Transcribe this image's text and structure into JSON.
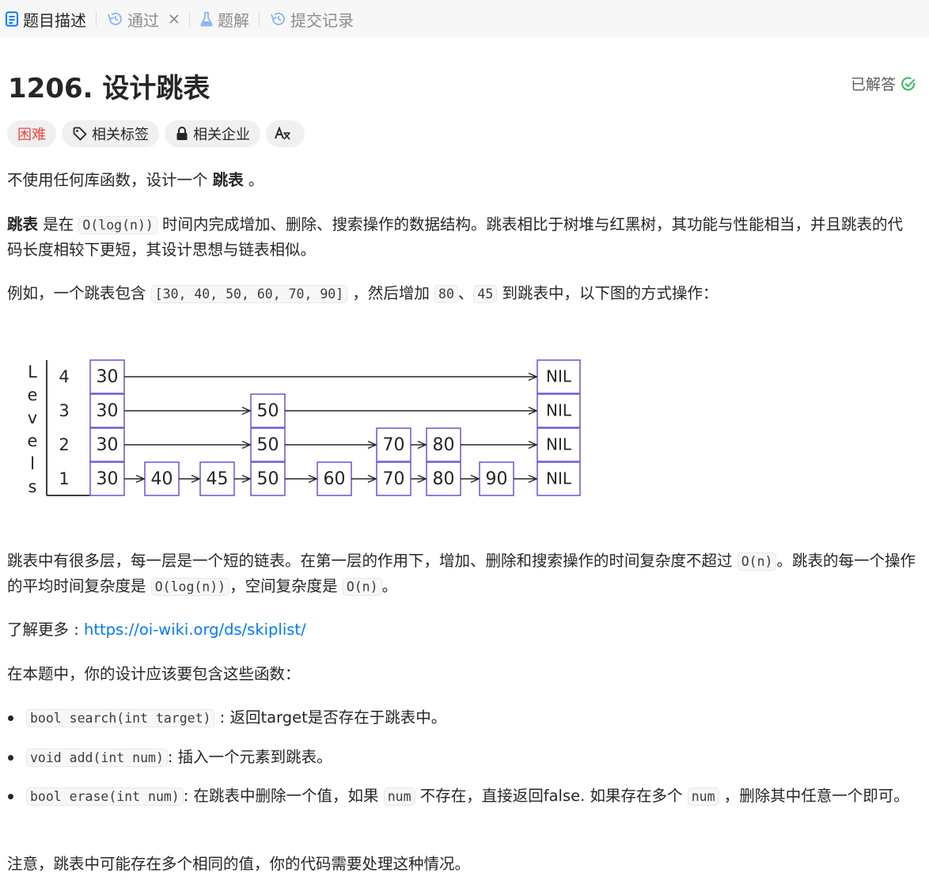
{
  "tabs": [
    {
      "label": "题目描述"
    },
    {
      "label": "通过"
    },
    {
      "label": "题解"
    },
    {
      "label": "提交记录"
    }
  ],
  "problem": {
    "title": "1206. 设计跳表",
    "status": "已解答"
  },
  "tags": {
    "difficulty": "困难",
    "related_tags": "相关标签",
    "related_companies": "相关企业"
  },
  "content": {
    "p1": {
      "a": "不使用任何库函数，设计一个 ",
      "b": "跳表",
      "c": " 。"
    },
    "p2": {
      "b": "跳表",
      "a": " 是在 ",
      "code": "O(log(n))",
      "c": " 时间内完成增加、删除、搜索操作的数据结构。跳表相比于树堆与红黑树，其功能与性能相当，并且跳表的代码长度相较下更短，其设计思想与链表相似。"
    },
    "p3": {
      "a": "例如，一个跳表包含 ",
      "code1": "[30, 40, 50, 60, 70, 90]",
      "b": " ，然后增加 ",
      "code2": "80",
      "c": "、",
      "code3": "45",
      "d": " 到跳表中，以下图的方式操作："
    },
    "p4": {
      "a": "跳表中有很多层，每一层是一个短的链表。在第一层的作用下，增加、删除和搜索操作的时间复杂度不超过 ",
      "code1": "O(n)",
      "b": "。跳表的每一个操作的平均时间复杂度是 ",
      "code2": "O(log(n))",
      "c": "，空间复杂度是 ",
      "code3": "O(n)",
      "d": "。"
    },
    "p5": {
      "a": "了解更多 : ",
      "link": "https://oi-wiki.org/ds/skiplist/"
    },
    "p6": "在本题中，你的设计应该要包含这些函数：",
    "bullets": [
      {
        "code": "bool search(int target)",
        "text": " : 返回target是否存在于跳表中。"
      },
      {
        "code": "void add(int num)",
        "text": ": 插入一个元素到跳表。"
      },
      {
        "code": "bool erase(int num)",
        "text1": ": 在跳表中删除一个值，如果 ",
        "code2": "num",
        "text2": " 不存在，直接返回false. 如果存在多个 ",
        "code3": "num",
        "text3": " ，删除其中任意一个即可。"
      }
    ],
    "p7": "注意，跳表中可能存在多个相同的值，你的代码需要处理这种情况。"
  },
  "diagram": {
    "levels_label": [
      "L",
      "e",
      "v",
      "e",
      "l",
      "s"
    ],
    "level_numbers": [
      "4",
      "3",
      "2",
      "1"
    ],
    "head": "30",
    "nil": "NIL",
    "nodes": [
      {
        "value": "40",
        "height": 1
      },
      {
        "value": "45",
        "height": 1
      },
      {
        "value": "50",
        "height": 3
      },
      {
        "value": "60",
        "height": 1
      },
      {
        "value": "70",
        "height": 2
      },
      {
        "value": "80",
        "height": 2
      },
      {
        "value": "90",
        "height": 1
      }
    ],
    "colors": {
      "box": "#6b63d8",
      "line": "#262626"
    }
  }
}
